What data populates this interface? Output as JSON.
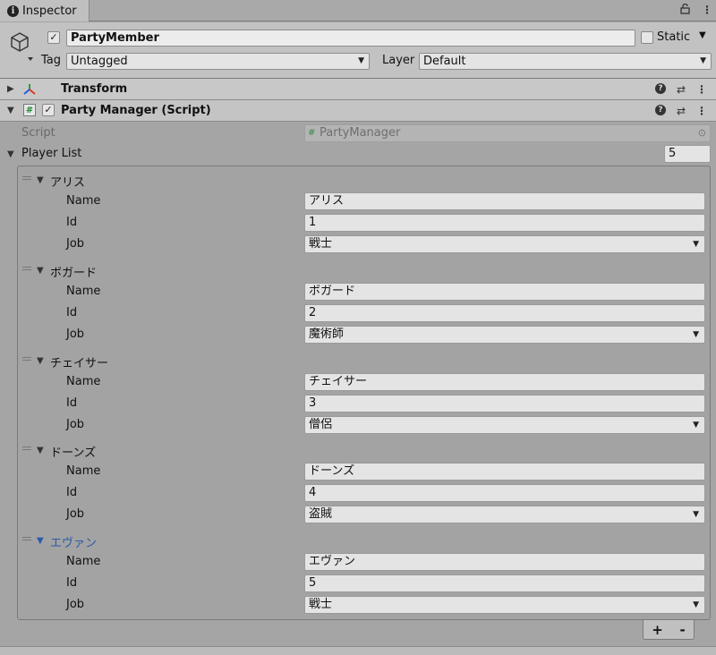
{
  "tab": {
    "title": "Inspector",
    "lock_glyph": "🔓",
    "menu_glyph": "⋮"
  },
  "gameobject": {
    "active_check": "✓",
    "name": "PartyMember",
    "static_label": "Static",
    "tag_label": "Tag",
    "tag_value": "Untagged",
    "layer_label": "Layer",
    "layer_value": "Default"
  },
  "components": {
    "transform": {
      "title": "Transform"
    },
    "party_manager": {
      "title": "Party Manager (Script)",
      "enabled_check": "✓",
      "script_label": "Script",
      "script_value": "PartyManager"
    }
  },
  "player_list": {
    "label": "Player List",
    "size": "5",
    "field_labels": {
      "name": "Name",
      "id": "Id",
      "job": "Job"
    },
    "items": [
      {
        "header": "アリス",
        "name": "アリス",
        "id": "1",
        "job": "戦士"
      },
      {
        "header": "ボガード",
        "name": "ボガード",
        "id": "2",
        "job": "魔術師"
      },
      {
        "header": "チェイサー",
        "name": "チェイサー",
        "id": "3",
        "job": "僧侶"
      },
      {
        "header": "ドーンズ",
        "name": "ドーンズ",
        "id": "4",
        "job": "盗賊"
      },
      {
        "header": "エヴァン",
        "name": "エヴァン",
        "id": "5",
        "job": "戦士"
      }
    ],
    "add_label": "+",
    "remove_label": "-"
  },
  "colors": {
    "selected_element": "#2b5aa8",
    "panel_bg": "#a5a5a5",
    "header_bg": "#c2c2c2"
  }
}
